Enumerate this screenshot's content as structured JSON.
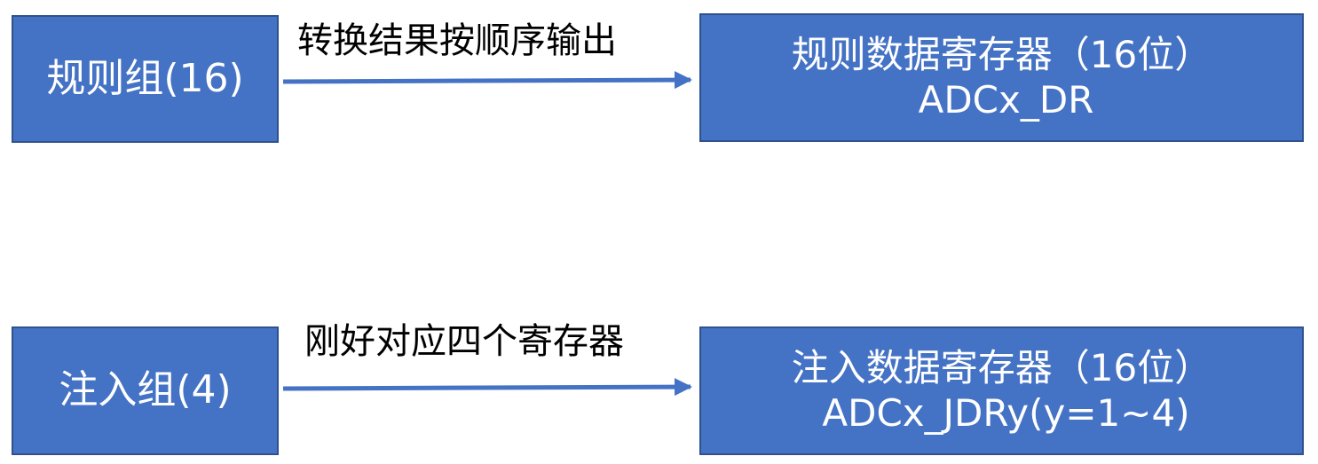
{
  "rows": [
    {
      "source_label": "规则组(16)",
      "edge_label": "转换结果按顺序输出",
      "target_line1": "规则数据寄存器（16位）",
      "target_line2": "ADCx_DR"
    },
    {
      "source_label": "注入组(4)",
      "edge_label": "刚好对应四个寄存器",
      "target_line1": "注入数据寄存器（16位）",
      "target_line2": "ADCx_JDRy(y=1~4)"
    }
  ],
  "colors": {
    "box_fill": "#4472c4",
    "box_border": "#2f528f",
    "arrow": "#4472c4",
    "box_text": "#ffffff",
    "label_text": "#000000"
  }
}
